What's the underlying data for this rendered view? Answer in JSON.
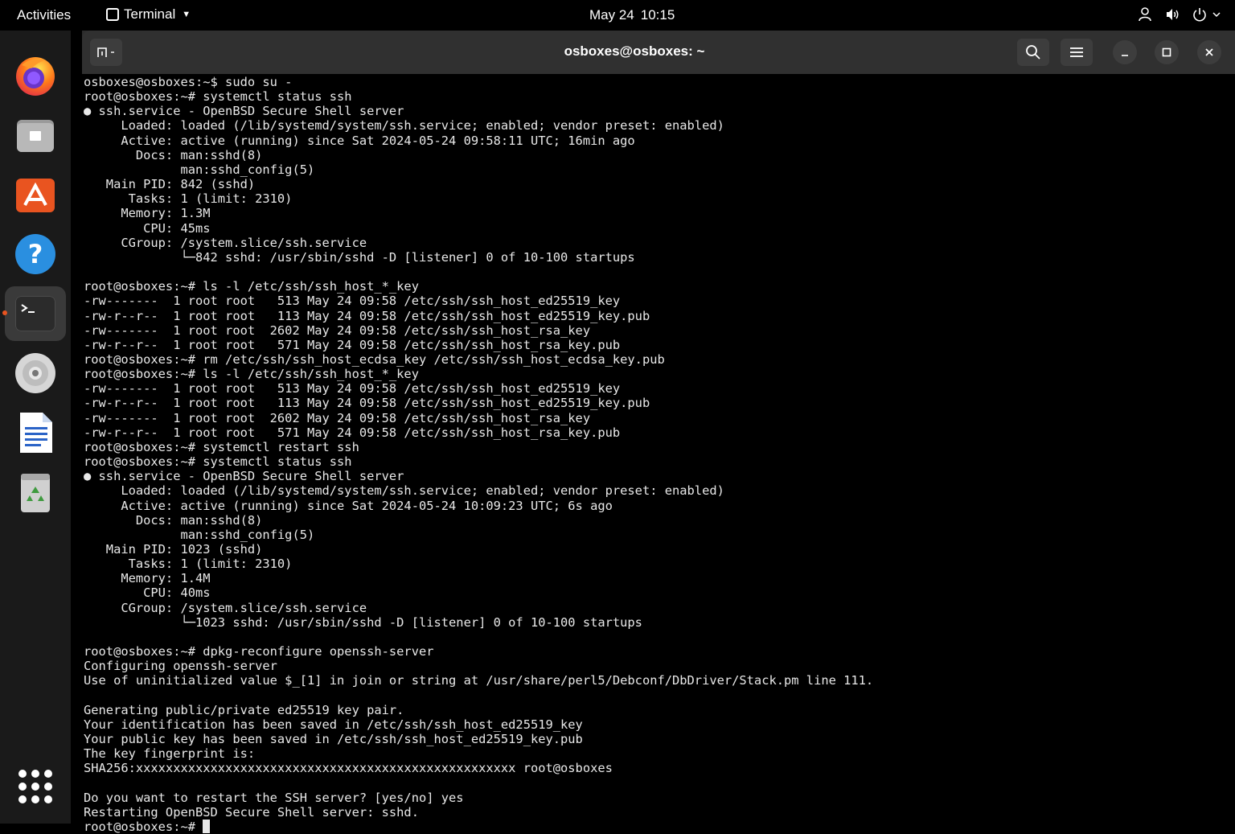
{
  "topbar": {
    "activities": "Activities",
    "app_name": "Terminal",
    "date": "May 24",
    "time": "10:15"
  },
  "dock": {
    "items": [
      {
        "name": "firefox-icon"
      },
      {
        "name": "files-icon"
      },
      {
        "name": "app-center-icon"
      },
      {
        "name": "help-icon"
      },
      {
        "name": "terminal-icon",
        "active": true
      },
      {
        "name": "disc-icon"
      },
      {
        "name": "text-editor-icon"
      },
      {
        "name": "trash-icon"
      },
      {
        "name": "show-apps-icon"
      }
    ]
  },
  "window": {
    "title": "osboxes@osboxes: ~"
  },
  "terminal": {
    "lines": [
      "osboxes@osboxes:~$ sudo su -",
      "root@osboxes:~# systemctl status ssh",
      "● ssh.service - OpenBSD Secure Shell server",
      "     Loaded: loaded (/lib/systemd/system/ssh.service; enabled; vendor preset: enabled)",
      "     Active: active (running) since Sat 2024-05-24 09:58:11 UTC; 16min ago",
      "       Docs: man:sshd(8)",
      "             man:sshd_config(5)",
      "   Main PID: 842 (sshd)",
      "      Tasks: 1 (limit: 2310)",
      "     Memory: 1.3M",
      "        CPU: 45ms",
      "     CGroup: /system.slice/ssh.service",
      "             └─842 sshd: /usr/sbin/sshd -D [listener] 0 of 10-100 startups",
      "",
      "root@osboxes:~# ls -l /etc/ssh/ssh_host_*_key",
      "-rw-------  1 root root   513 May 24 09:58 /etc/ssh/ssh_host_ed25519_key",
      "-rw-r--r--  1 root root   113 May 24 09:58 /etc/ssh/ssh_host_ed25519_key.pub",
      "-rw-------  1 root root  2602 May 24 09:58 /etc/ssh/ssh_host_rsa_key",
      "-rw-r--r--  1 root root   571 May 24 09:58 /etc/ssh/ssh_host_rsa_key.pub",
      "root@osboxes:~# rm /etc/ssh/ssh_host_ecdsa_key /etc/ssh/ssh_host_ecdsa_key.pub",
      "root@osboxes:~# ls -l /etc/ssh/ssh_host_*_key",
      "-rw-------  1 root root   513 May 24 09:58 /etc/ssh/ssh_host_ed25519_key",
      "-rw-r--r--  1 root root   113 May 24 09:58 /etc/ssh/ssh_host_ed25519_key.pub",
      "-rw-------  1 root root  2602 May 24 09:58 /etc/ssh/ssh_host_rsa_key",
      "-rw-r--r--  1 root root   571 May 24 09:58 /etc/ssh/ssh_host_rsa_key.pub",
      "root@osboxes:~# systemctl restart ssh",
      "root@osboxes:~# systemctl status ssh",
      "● ssh.service - OpenBSD Secure Shell server",
      "     Loaded: loaded (/lib/systemd/system/ssh.service; enabled; vendor preset: enabled)",
      "     Active: active (running) since Sat 2024-05-24 10:09:23 UTC; 6s ago",
      "       Docs: man:sshd(8)",
      "             man:sshd_config(5)",
      "   Main PID: 1023 (sshd)",
      "      Tasks: 1 (limit: 2310)",
      "     Memory: 1.4M",
      "        CPU: 40ms",
      "     CGroup: /system.slice/ssh.service",
      "             └─1023 sshd: /usr/sbin/sshd -D [listener] 0 of 10-100 startups",
      "",
      "root@osboxes:~# dpkg-reconfigure openssh-server",
      "Configuring openssh-server",
      "Use of uninitialized value $_[1] in join or string at /usr/share/perl5/Debconf/DbDriver/Stack.pm line 111.",
      "",
      "Generating public/private ed25519 key pair.",
      "Your identification has been saved in /etc/ssh/ssh_host_ed25519_key",
      "Your public key has been saved in /etc/ssh/ssh_host_ed25519_key.pub",
      "The key fingerprint is:",
      "SHA256:xxxxxxxxxxxxxxxxxxxxxxxxxxxxxxxxxxxxxxxxxxxxxxxxxxx root@osboxes",
      "",
      "Do you want to restart the SSH server? [yes/no] yes",
      "Restarting OpenBSD Secure Shell server: sshd.",
      "root@osboxes:~# "
    ]
  }
}
